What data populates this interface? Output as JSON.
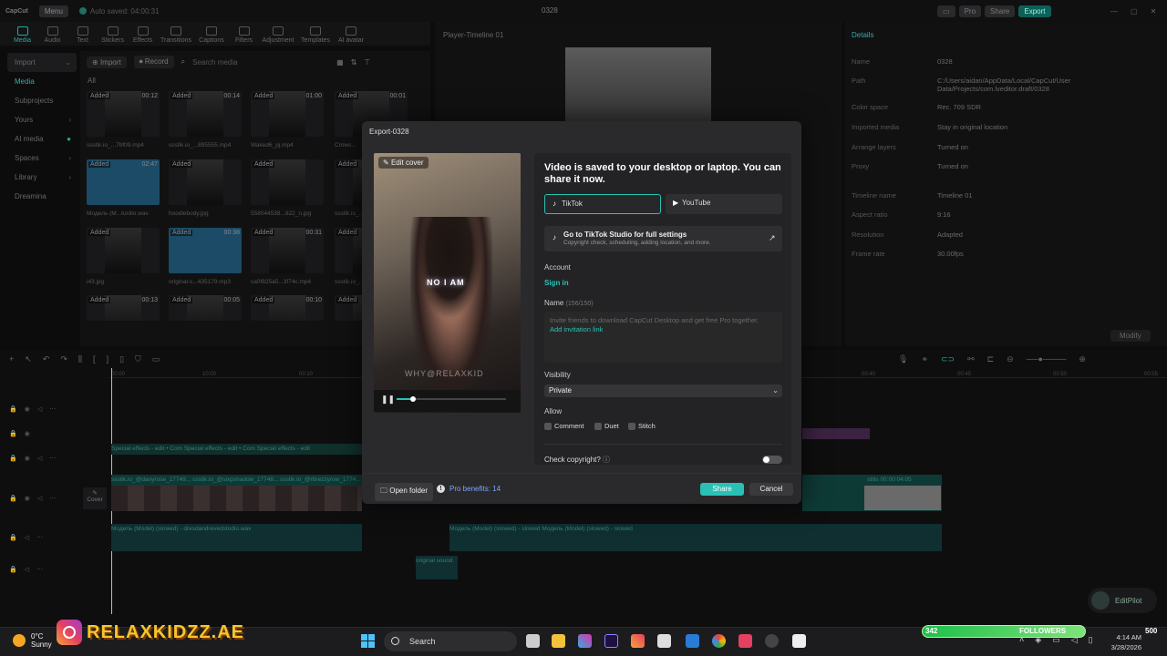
{
  "app": {
    "logo": "CapCut",
    "menu": "Menu",
    "autosave": "Auto saved: 04:00:31",
    "project_title": "0328",
    "pro": "Pro",
    "share": "Share",
    "export": "Export"
  },
  "toolbar": [
    "Media",
    "Audio",
    "Text",
    "Stickers",
    "Effects",
    "Transitions",
    "Captions",
    "Filters",
    "Adjustment",
    "Templates",
    "AI avatar"
  ],
  "leftnav": [
    {
      "label": "Import"
    },
    {
      "label": "Media"
    },
    {
      "label": "Subprojects"
    },
    {
      "label": "Yours"
    },
    {
      "label": "AI media"
    },
    {
      "label": "Spaces"
    },
    {
      "label": "Library"
    },
    {
      "label": "Dreamina"
    }
  ],
  "media": {
    "import": "Import",
    "record": "Record",
    "search_placeholder": "Search media",
    "all": "All",
    "added": "Added",
    "items": [
      {
        "dur": "00:12",
        "name": "ssstik.io_...7bf09.mp4"
      },
      {
        "dur": "00:14",
        "name": "ssstik.io_...895555.mp4"
      },
      {
        "dur": "01:00",
        "name": "Waked6_pj.mp4"
      },
      {
        "dur": "00:01",
        "name": "Crows..."
      },
      {
        "dur": "02:47",
        "name": "Модель (M...turdio.wav"
      },
      {
        "dur": "",
        "name": "hoodiebody.jpg"
      },
      {
        "dur": "",
        "name": "558044538...822_n.jpg"
      },
      {
        "dur": "",
        "name": "ssstik.io_..."
      },
      {
        "dur": "",
        "name": "i43.jpg"
      },
      {
        "dur": "00:38",
        "name": "original-s...435179.mp3"
      },
      {
        "dur": "00:31",
        "name": "ca0f825a5...3f74c.mp4"
      },
      {
        "dur": "",
        "name": "ssstik.io_..."
      },
      {
        "dur": "00:13",
        "name": ""
      },
      {
        "dur": "00:05",
        "name": ""
      },
      {
        "dur": "00:10",
        "name": ""
      },
      {
        "dur": "",
        "name": ""
      }
    ]
  },
  "player": {
    "title": "Player-Timeline 01"
  },
  "details": {
    "title": "Details",
    "rows": [
      {
        "k": "Name",
        "v": "0328"
      },
      {
        "k": "Path",
        "v": "C:/Users/aidan/AppData/Local/CapCut/User Data/Projects/com.lveditor.draft/0328"
      },
      {
        "k": "Color space",
        "v": "Rec. 709 SDR"
      },
      {
        "k": "Imported media",
        "v": "Stay in original location"
      },
      {
        "k": "Arrange layers",
        "v": "Turned on"
      },
      {
        "k": "Proxy",
        "v": "Turned on"
      },
      {
        "k": "Timeline name",
        "v": "Timeline 01"
      },
      {
        "k": "Aspect ratio",
        "v": "9:16"
      },
      {
        "k": "Resolution",
        "v": "Adapted"
      },
      {
        "k": "Frame rate",
        "v": "30.00fps"
      }
    ],
    "modify": "Modify"
  },
  "timeline": {
    "ruler": [
      "00:00",
      "10:00",
      "00:10",
      "00:15",
      "00:40",
      "00:45",
      "00:50",
      "00:55"
    ],
    "effects_track": "Special effects - edit • Com  Special effects - edit • Com  Special effects - edit",
    "video_track": "ssstik.io_@danyrose_17749...   ssstik.io_@sixpshadow_17748...   ssstik.io_@rbrezzyrow_1774...",
    "audio_track": "Модель (Model) (slowed) - dresdandrevedstodio.wav",
    "audio_track_right": "Модель (Model) (slowed) - slowed  Модель (Model) (slowed) - slowed",
    "original_sound": "original sound",
    "cover": "Cover",
    "clip_right": "stills  00:00:04:05"
  },
  "dialog": {
    "title": "Export-0328",
    "edit_cover": "Edit cover",
    "overlay_text": "NO I AM",
    "watermark": "WHY@RELAXKID",
    "progress": 0.15,
    "headline": "Video is saved to your desktop or laptop. You can share it now.",
    "tiktok": "TikTok",
    "youtube": "YouTube",
    "studio_title": "Go to TikTok Studio for full settings",
    "studio_sub": "Copyright check, scheduling, adding location, and more.",
    "account_label": "Account",
    "sign_in": "Sign in",
    "name_label": "Name",
    "name_count": "(156/150)",
    "name_value": "Invite friends to download CapCut Desktop and get free Pro together.",
    "invite_link": "Add invitation link",
    "visibility_label": "Visibility",
    "visibility_value": "Private",
    "allow_label": "Allow",
    "allow": [
      "Comment",
      "Duet",
      "Stitch"
    ],
    "copyright": "Check copyright?",
    "open_folder": "Open folder",
    "pro_benefits": "Pro benefits: 14",
    "share": "Share",
    "cancel": "Cancel"
  },
  "edit_pilot": "EditPilot",
  "taskbar": {
    "temp": "0°C",
    "weather": "Sunny",
    "brand": "RELAXKIDZZ.AE",
    "search": "Search",
    "followers_count": "342",
    "followers_label": "FOLLOWERS",
    "followers_goal": "500",
    "time": "4:14 AM",
    "date": "3/28/2026"
  }
}
